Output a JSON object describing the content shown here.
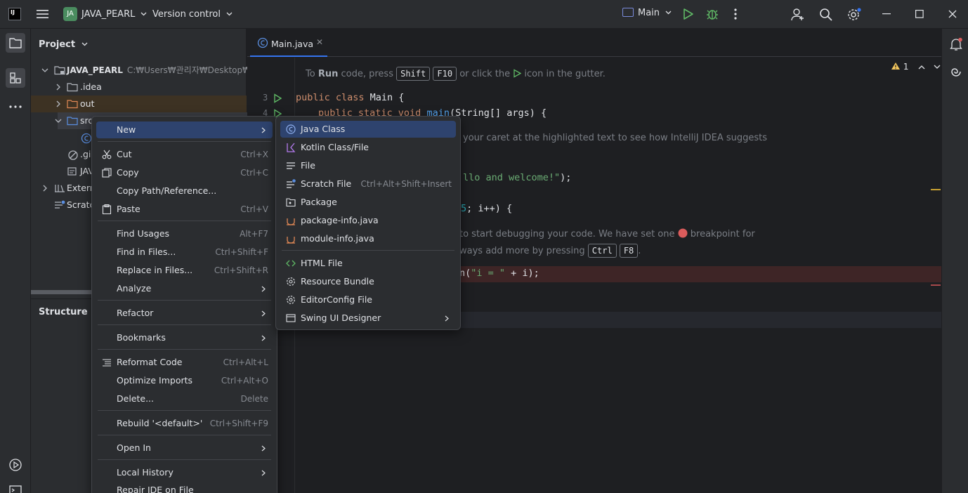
{
  "titlebar": {
    "logo": "IJ",
    "project_badge": "JA",
    "project_name": "JAVA_PEARL",
    "vcs_label": "Version control",
    "run_config": "Main"
  },
  "project_panel": {
    "title": "Project",
    "root_name": "JAVA_PEARL",
    "root_path": "C:₩Users₩관리자₩Desktop₩proje",
    "items": [
      {
        "label": ".idea"
      },
      {
        "label": "out"
      },
      {
        "label": "src"
      },
      {
        "label": ".gi"
      },
      {
        "label": "JAV"
      },
      {
        "label": "Externa"
      },
      {
        "label": "Scratc"
      }
    ],
    "structure_title": "Structure"
  },
  "editor": {
    "tab_label": "Main.java",
    "warning_count": "1",
    "hint": {
      "prefix": "To ",
      "run": "Run",
      "mid": " code, press ",
      "key1": "Shift",
      "key2": "F10",
      "suffix": " or click the ",
      "suffix2": " icon in the gutter."
    },
    "line_numbers": [
      "3",
      "4"
    ],
    "code": {
      "line1_kw": "public class ",
      "line1_rest": "Main {",
      "line2_kw": "public static void ",
      "line2_fn": "main",
      "line2_rest": "(String[] args) {",
      "comment1": "your caret at the highlighted text to see how IntelliJ IDEA suggests",
      "line3_str": "llo and welcome!\"",
      "line3_rest": ");",
      "line4_num": "5",
      "line4_rest": "; i++) {",
      "comment2_a": "to start debugging your code. We have set one ",
      "comment2_b": " breakpoint for",
      "comment3": "ways add more by pressing ",
      "key3": "Ctrl",
      "key4": "F8",
      "line5_a": "n(",
      "line5_str": "\"i = \"",
      "line5_rest": " + i);"
    }
  },
  "context_menu": {
    "items": [
      {
        "label": "New",
        "shortcut": "",
        "submenu": true
      },
      {
        "label": "Cut",
        "shortcut": "Ctrl+X"
      },
      {
        "label": "Copy",
        "shortcut": "Ctrl+C"
      },
      {
        "label": "Copy Path/Reference...",
        "shortcut": ""
      },
      {
        "label": "Paste",
        "shortcut": "Ctrl+V"
      },
      {
        "label": "Find Usages",
        "shortcut": "Alt+F7"
      },
      {
        "label": "Find in Files...",
        "shortcut": "Ctrl+Shift+F"
      },
      {
        "label": "Replace in Files...",
        "shortcut": "Ctrl+Shift+R"
      },
      {
        "label": "Analyze",
        "shortcut": "",
        "submenu": true
      },
      {
        "label": "Refactor",
        "shortcut": "",
        "submenu": true
      },
      {
        "label": "Bookmarks",
        "shortcut": "",
        "submenu": true
      },
      {
        "label": "Reformat Code",
        "shortcut": "Ctrl+Alt+L"
      },
      {
        "label": "Optimize Imports",
        "shortcut": "Ctrl+Alt+O"
      },
      {
        "label": "Delete...",
        "shortcut": "Delete"
      },
      {
        "label": "Rebuild '<default>'",
        "shortcut": "Ctrl+Shift+F9"
      },
      {
        "label": "Open In",
        "shortcut": "",
        "submenu": true
      },
      {
        "label": "Local History",
        "shortcut": "",
        "submenu": true
      },
      {
        "label": "Repair IDE on File",
        "shortcut": ""
      }
    ]
  },
  "new_submenu": {
    "items": [
      {
        "label": "Java Class",
        "shortcut": ""
      },
      {
        "label": "Kotlin Class/File",
        "shortcut": ""
      },
      {
        "label": "File",
        "shortcut": ""
      },
      {
        "label": "Scratch File",
        "shortcut": "Ctrl+Alt+Shift+Insert"
      },
      {
        "label": "Package",
        "shortcut": ""
      },
      {
        "label": "package-info.java",
        "shortcut": ""
      },
      {
        "label": "module-info.java",
        "shortcut": ""
      },
      {
        "label": "HTML File",
        "shortcut": ""
      },
      {
        "label": "Resource Bundle",
        "shortcut": ""
      },
      {
        "label": "EditorConfig File",
        "shortcut": ""
      },
      {
        "label": "Swing UI Designer",
        "shortcut": "",
        "submenu": true
      }
    ]
  },
  "colors": {
    "accent": "#3574f0",
    "selection": "#2e436e",
    "run_green": "#5fb865",
    "breakpoint_red": "#db5c5c"
  }
}
